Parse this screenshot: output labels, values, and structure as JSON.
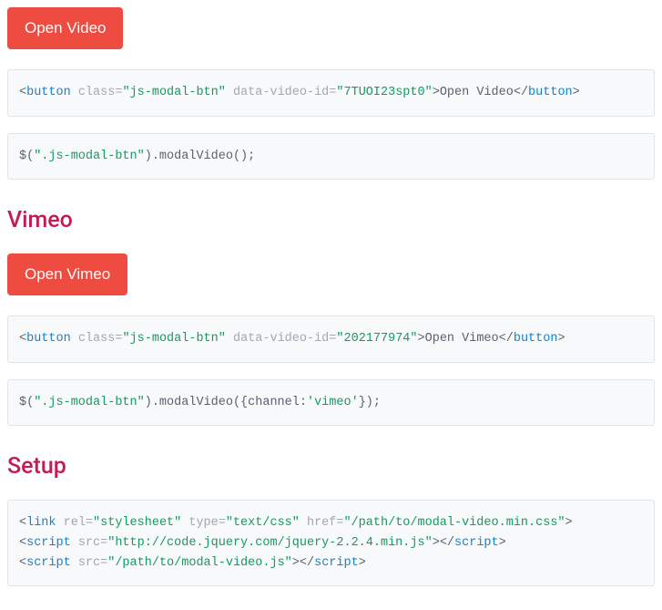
{
  "buttons": {
    "openVideo": "Open Video",
    "openVimeo": "Open Vimeo"
  },
  "headings": {
    "vimeo": "Vimeo",
    "setup": "Setup"
  },
  "code": {
    "block1": {
      "openTag": "button",
      "attrClass": " class=",
      "classVal": "\"js-modal-btn\"",
      "attrData": " data-video-id=",
      "dataVal": "\"7TUOI23spt0\"",
      "gt": ">",
      "text": "Open Video",
      "closeLt": "</",
      "closeTag": "button",
      "closeGt": ">"
    },
    "block2": {
      "p1": "$(",
      "str": "\".js-modal-btn\"",
      "p2": ").modalVideo();"
    },
    "block3": {
      "openTag": "button",
      "attrClass": " class=",
      "classVal": "\"js-modal-btn\"",
      "attrData": " data-video-id=",
      "dataVal": "\"202177974\"",
      "gt": ">",
      "text": "Open Vimeo",
      "closeLt": "</",
      "closeTag": "button",
      "closeGt": ">"
    },
    "block4": {
      "p1": "$(",
      "str": "\".js-modal-btn\"",
      "p2": ").modalVideo({channel:",
      "str2": "'vimeo'",
      "p3": "});"
    },
    "block5": {
      "l1_lt": "<",
      "l1_tag": "link",
      "l1_a1": " rel=",
      "l1_v1": "\"stylesheet\"",
      "l1_a2": " type=",
      "l1_v2": "\"text/css\"",
      "l1_a3": " href=",
      "l1_v3": "\"/path/to/modal-video.min.css\"",
      "l1_gt": ">",
      "l2_lt": "<",
      "l2_tag": "script",
      "l2_a1": " src=",
      "l2_v1": "\"http://code.jquery.com/jquery-2.2.4.min.js\"",
      "l2_gt": ">",
      "l2_clt": "</",
      "l2_ctag": "script",
      "l2_cgt": ">",
      "l3_lt": "<",
      "l3_tag": "script",
      "l3_a1": " src=",
      "l3_v1": "\"/path/to/modal-video.js\"",
      "l3_gt": ">",
      "l3_clt": "</",
      "l3_ctag": "script",
      "l3_cgt": ">"
    }
  }
}
